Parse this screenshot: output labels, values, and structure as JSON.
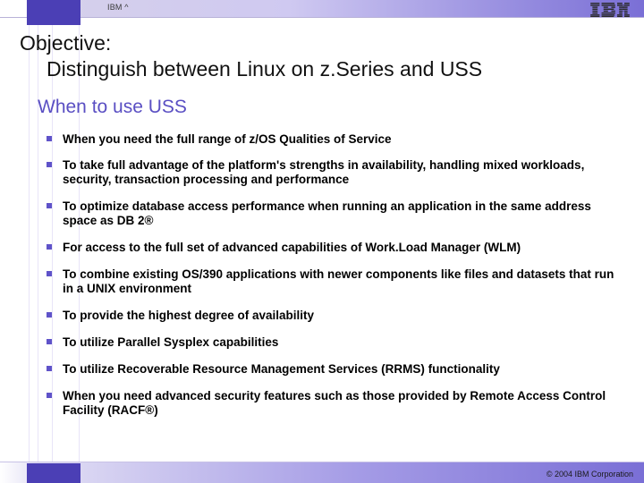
{
  "header": {
    "product_label": "IBM ^",
    "logo_alt": "IBM"
  },
  "objective": {
    "label": "Objective:",
    "text": "Distinguish between Linux on z.Series and USS"
  },
  "section_title": "When to use USS",
  "bullets": [
    "When you need the full range of z/OS Qualities of Service",
    "To take full advantage of the platform's strengths in availability, handling mixed workloads, security, transaction processing and performance",
    "To optimize database access performance when running an application in the same address space as DB 2®",
    "For access to the full set of advanced capabilities of Work.Load Manager (WLM)",
    "To combine existing OS/390 applications with newer components like files and datasets that run in a UNIX environment",
    "To provide the highest degree of availability",
    "To utilize Parallel Sysplex capabilities",
    "To utilize Recoverable Resource Management Services (RRMS) functionality",
    "When you need advanced security features such as those provided by Remote Access Control Facility (RACF®)"
  ],
  "footer": {
    "copyright": "© 2004 IBM Corporation"
  }
}
